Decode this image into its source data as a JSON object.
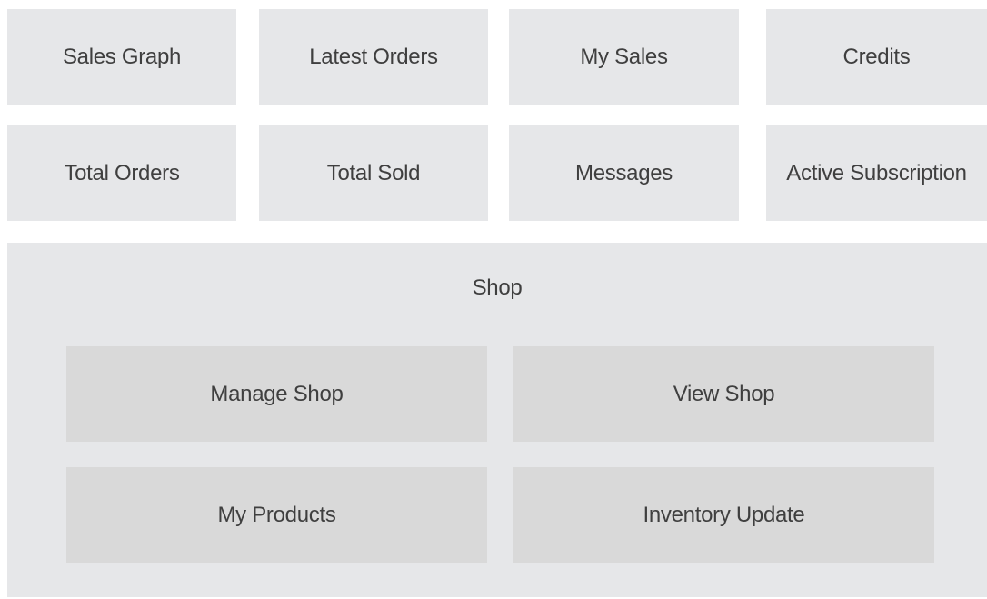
{
  "dashboard": {
    "row1": [
      "Sales Graph",
      "Latest Orders",
      "My Sales",
      "Credits"
    ],
    "row2": [
      "Total Orders",
      "Total Sold",
      "Messages",
      "Active Subscription"
    ]
  },
  "shop": {
    "title": "Shop",
    "items": [
      "Manage Shop",
      "View Shop",
      "My Products",
      "Inventory Update"
    ]
  }
}
